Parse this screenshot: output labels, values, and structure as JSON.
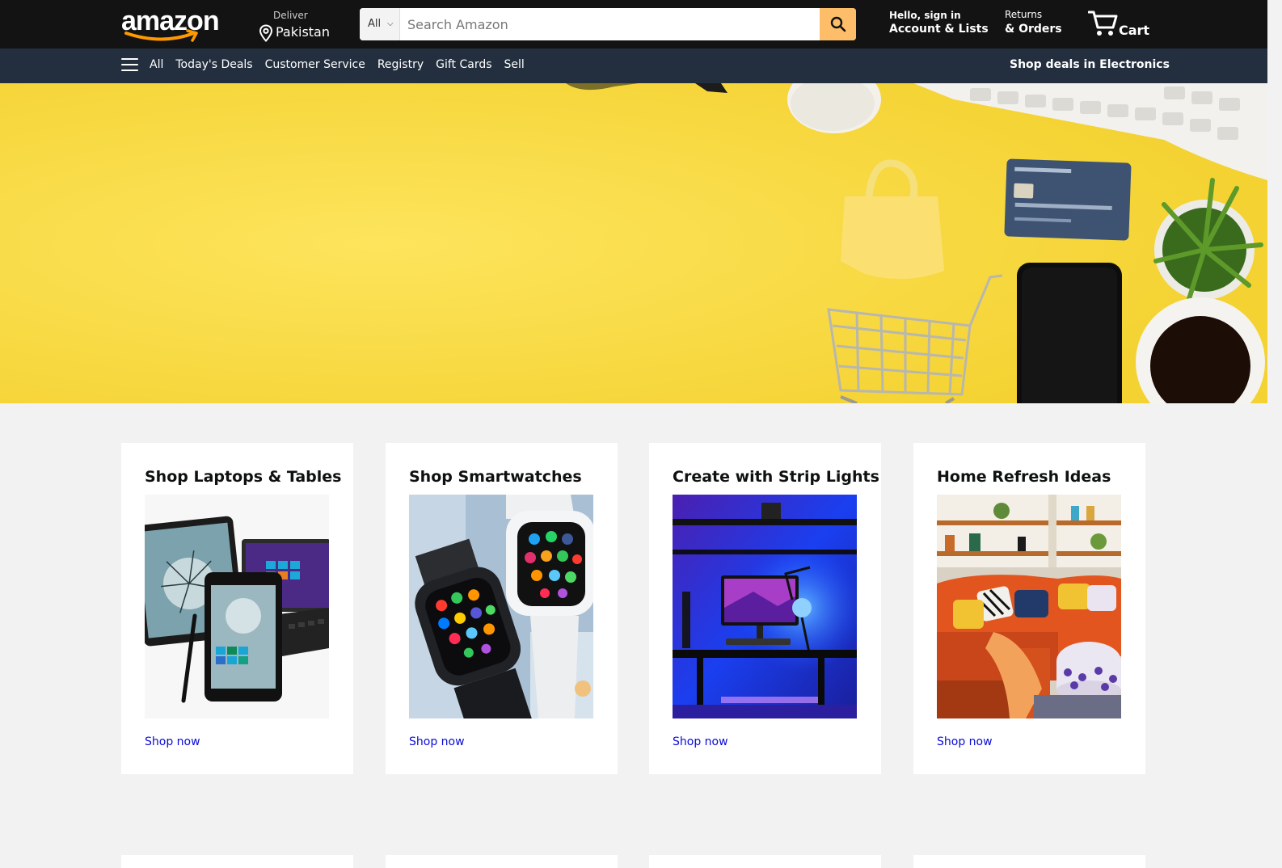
{
  "header": {
    "logo_text": "amazon",
    "deliver_label": "Deliver",
    "deliver_country": "Pakistan",
    "search_category": "All",
    "search_placeholder": "Search Amazon",
    "account_greeting": "Hello, sign in",
    "account_label": "Account & Lists",
    "returns_label": "Returns",
    "orders_label": "& Orders",
    "cart_label": "Cart"
  },
  "nav": {
    "all": "All",
    "items": [
      "Today's Deals",
      "Customer Service",
      "Registry",
      "Gift Cards",
      "Sell"
    ],
    "promo": "Shop deals in Electronics"
  },
  "cards": [
    {
      "title": "Shop Laptops & Tables",
      "link": "Shop now"
    },
    {
      "title": "Shop Smartwatches",
      "link": "Shop now"
    },
    {
      "title": "Create with Strip Lights",
      "link": "Shop now"
    },
    {
      "title": "Home Refresh Ideas",
      "link": "Shop now"
    }
  ],
  "colors": {
    "header_bg": "#131313",
    "nav_bg": "#232f3e",
    "search_button": "#febd69",
    "hero_yellow": "#f8d83c",
    "link_blue": "#0a0ad6"
  },
  "icons": {
    "location": "location-pin-icon",
    "search": "magnifier-icon",
    "cart": "shopping-cart-icon",
    "menu": "hamburger-menu-icon"
  }
}
